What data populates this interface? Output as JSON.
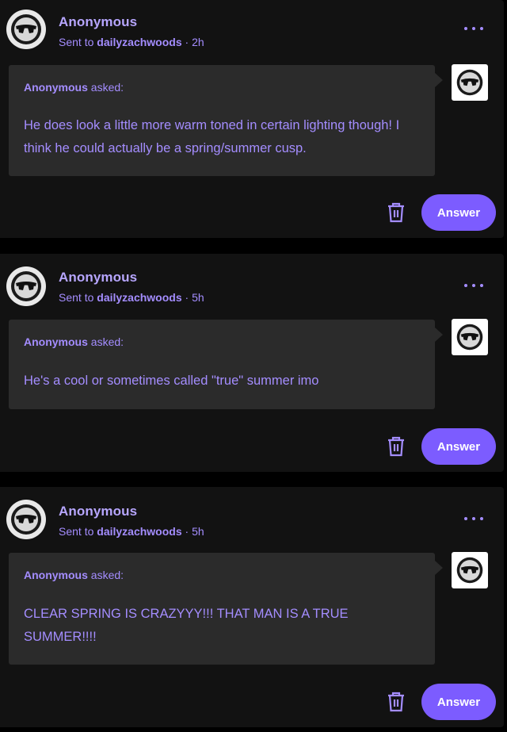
{
  "colors": {
    "page_background": "#000000",
    "card_background": "#121212",
    "bubble_background": "#2b2b2b",
    "accent_text": "#a48dff",
    "answer_button": "#7c5cff"
  },
  "posts": [
    {
      "sender": "Anonymous",
      "sent_prefix": "Sent to",
      "blog": "dailyzachwoods",
      "separator": "·",
      "time": "2h",
      "asker": "Anonymous",
      "asked_suffix": "asked:",
      "question": "He does look a little more warm toned in certain lighting though! I think he could actually be a spring/summer cusp.",
      "answer_label": "Answer",
      "icons": {
        "avatar": "sunglasses-avatar-icon",
        "more": "more-options-icon",
        "delete": "trash-icon"
      }
    },
    {
      "sender": "Anonymous",
      "sent_prefix": "Sent to",
      "blog": "dailyzachwoods",
      "separator": "·",
      "time": "5h",
      "asker": "Anonymous",
      "asked_suffix": "asked:",
      "question": "He's a cool or sometimes called \"true\" summer imo",
      "answer_label": "Answer",
      "icons": {
        "avatar": "sunglasses-avatar-icon",
        "more": "more-options-icon",
        "delete": "trash-icon"
      }
    },
    {
      "sender": "Anonymous",
      "sent_prefix": "Sent to",
      "blog": "dailyzachwoods",
      "separator": "·",
      "time": "5h",
      "asker": "Anonymous",
      "asked_suffix": "asked:",
      "question": "CLEAR SPRING IS CRAZYYY!!! THAT MAN IS A TRUE SUMMER!!!!",
      "answer_label": "Answer",
      "icons": {
        "avatar": "sunglasses-avatar-icon",
        "more": "more-options-icon",
        "delete": "trash-icon"
      }
    }
  ]
}
